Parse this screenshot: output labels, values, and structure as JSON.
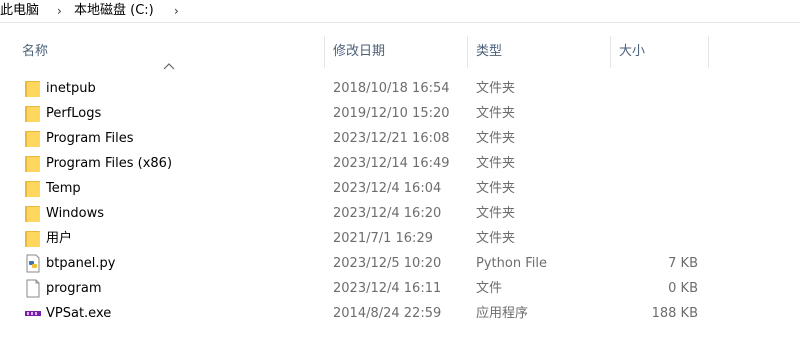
{
  "breadcrumb": {
    "items": [
      {
        "label": "此电脑"
      },
      {
        "label": "本地磁盘 (C:)"
      }
    ]
  },
  "columns": {
    "name": "名称",
    "date": "修改日期",
    "type": "类型",
    "size": "大小"
  },
  "files": [
    {
      "name": "inetpub",
      "date": "2018/10/18 16:54",
      "type": "文件夹",
      "size": "",
      "icon": "folder-icon"
    },
    {
      "name": "PerfLogs",
      "date": "2019/12/10 15:20",
      "type": "文件夹",
      "size": "",
      "icon": "folder-icon"
    },
    {
      "name": "Program Files",
      "date": "2023/12/21 16:08",
      "type": "文件夹",
      "size": "",
      "icon": "folder-icon"
    },
    {
      "name": "Program Files (x86)",
      "date": "2023/12/14 16:49",
      "type": "文件夹",
      "size": "",
      "icon": "folder-icon"
    },
    {
      "name": "Temp",
      "date": "2023/12/4 16:04",
      "type": "文件夹",
      "size": "",
      "icon": "folder-icon"
    },
    {
      "name": "Windows",
      "date": "2023/12/4 16:20",
      "type": "文件夹",
      "size": "",
      "icon": "folder-icon"
    },
    {
      "name": "用户",
      "date": "2021/7/1 16:29",
      "type": "文件夹",
      "size": "",
      "icon": "folder-icon"
    },
    {
      "name": "btpanel.py",
      "date": "2023/12/5 10:20",
      "type": "Python File",
      "size": "7 KB",
      "icon": "python-file-icon"
    },
    {
      "name": "program",
      "date": "2023/12/4 16:11",
      "type": "文件",
      "size": "0 KB",
      "icon": "blank-file-icon"
    },
    {
      "name": "VPSat.exe",
      "date": "2014/8/24 22:59",
      "type": "应用程序",
      "size": "188 KB",
      "icon": "exe-app-icon"
    }
  ],
  "colors": {
    "folder": "#ffd75e",
    "header_text": "#4c607a",
    "secondary_text": "#6d6d6d",
    "hover": "#e5f3ff"
  }
}
